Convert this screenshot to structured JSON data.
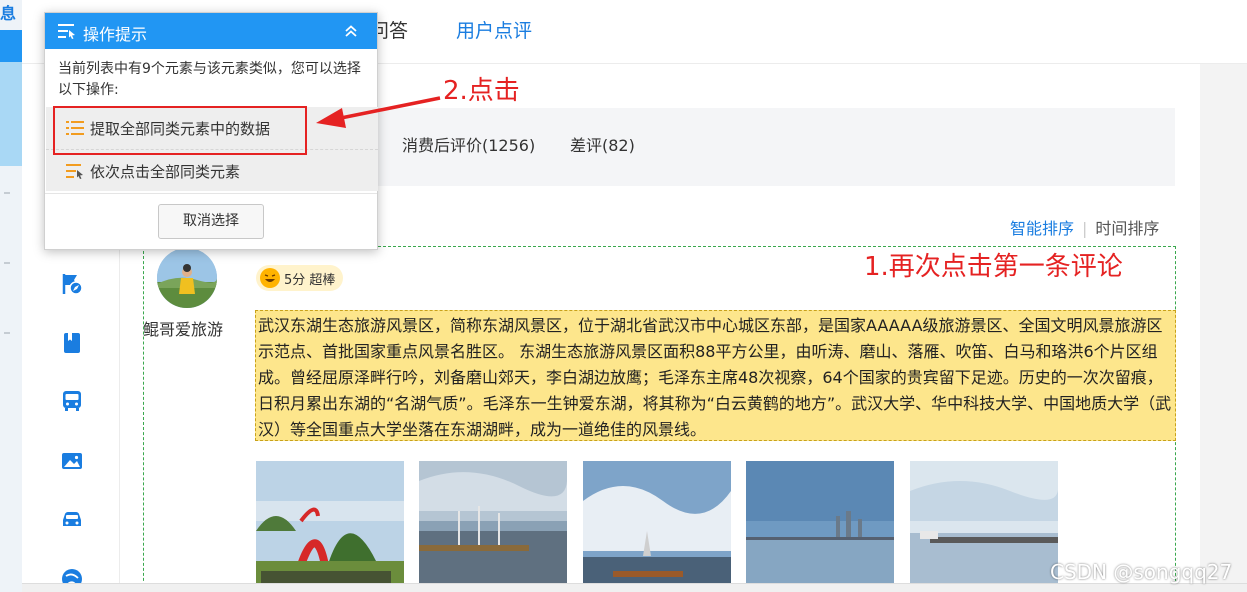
{
  "top_nav": {
    "item_partial": "问答",
    "item_active": "用户点评"
  },
  "filters": {
    "after_consumption": "消费后评价(1256)",
    "negative": "差评(82)"
  },
  "sort": {
    "smart": "智能排序",
    "separator": "|",
    "time": "时间排序"
  },
  "review": {
    "username": "鲲哥爱旅游",
    "score_label": "5分 超棒",
    "text": "武汉东湖生态旅游风景区，简称东湖风景区，位于湖北省武汉市中心城区东部，是国家AAAAA级旅游景区、全国文明风景旅游区示范点、首批国家重点风景名胜区。 东湖生态旅游风景区面积88平方公里，由听涛、磨山、落雁、吹笛、白马和珞洪6个片区组成。曾经屈原泽畔行吟，刘备磨山郊天，李白湖边放鹰；毛泽东主席48次视察，64个国家的贵宾留下足迹。历史的一次次留痕，日积月累出东湖的“名湖气质”。毛泽东一生钟爱东湖，将其称为“白云黄鹤的地方”。武汉大学、华中科技大学、中国地质大学（武汉）等全国重点大学坐落在东湖湖畔，成为一道绝佳的风景线。",
    "photo_count": 5
  },
  "popup": {
    "title": "操作提示",
    "description": "当前列表中有9个元素与该元素类似，您可以选择以下操作:",
    "option_extract": "提取全部同类元素中的数据",
    "option_click": "依次点击全部同类元素",
    "cancel": "取消选择"
  },
  "annotations": {
    "step1": "1.再次点击第一条评论",
    "step2": "2.点击"
  },
  "left_strip_glyph": "息",
  "watermark": "CSDN @songqq27",
  "colors": {
    "accent": "#2196f3",
    "annotation": "#e52222",
    "highlight": "#fde68c",
    "selection_border": "#3aa84e"
  },
  "nav_icons": [
    "compass-flag-icon",
    "book-icon",
    "bus-icon",
    "photo-icon",
    "car-icon",
    "globe-icon"
  ]
}
